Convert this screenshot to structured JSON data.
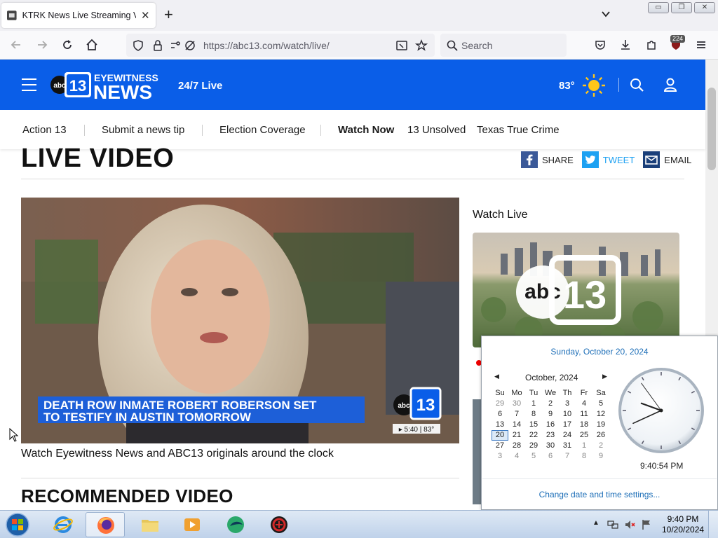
{
  "browser": {
    "tab_title": "KTRK News Live Streaming Vide",
    "url": "https://abc13.com/watch/live/",
    "search_placeholder": "Search",
    "extension_badge": "224"
  },
  "site": {
    "logo_text_top": "EYEWITNESS",
    "logo_text_bottom": "NEWS",
    "logo_badge": "abc13",
    "live_label": "24/7 Live",
    "temperature": "83°",
    "nav": [
      "Action 13",
      "Submit a news tip",
      "Election Coverage",
      "Watch Now",
      "13 Unsolved",
      "Texas True Crime"
    ]
  },
  "page": {
    "title": "LIVE VIDEO",
    "share": {
      "facebook": "SHARE",
      "twitter": "TWEET",
      "email": "EMAIL"
    },
    "video": {
      "lower_third_line1": "DEATH ROW INMATE ROBERT ROBERSON SET",
      "lower_third_line2": "TO TESTIFY IN AUSTIN TOMORROW",
      "bug": "abc13",
      "ticker": "▸ 5:40 | 83°"
    },
    "video_caption": "Watch Eyewitness News and ABC13 originals around the clock",
    "recommended_title": "RECOMMENDED VIDEO",
    "sidebar_heading": "Watch Live",
    "thumb_logo": "abc13"
  },
  "clock_popup": {
    "long_date": "Sunday, October 20, 2024",
    "month_label": "October, 2024",
    "weekdays": [
      "Su",
      "Mo",
      "Tu",
      "We",
      "Th",
      "Fr",
      "Sa"
    ],
    "weeks": [
      [
        "29",
        "30",
        "1",
        "2",
        "3",
        "4",
        "5"
      ],
      [
        "6",
        "7",
        "8",
        "9",
        "10",
        "11",
        "12"
      ],
      [
        "13",
        "14",
        "15",
        "16",
        "17",
        "18",
        "19"
      ],
      [
        "20",
        "21",
        "22",
        "23",
        "24",
        "25",
        "26"
      ],
      [
        "27",
        "28",
        "29",
        "30",
        "31",
        "1",
        "2"
      ],
      [
        "3",
        "4",
        "5",
        "6",
        "7",
        "8",
        "9"
      ]
    ],
    "today": "20",
    "digital_time": "9:40:54 PM",
    "settings_link": "Change date and time settings..."
  },
  "taskbar": {
    "time": "9:40 PM",
    "date": "10/20/2024",
    "apps": [
      "internet-explorer",
      "firefox",
      "file-explorer",
      "media-player",
      "app-green",
      "app-red"
    ]
  },
  "colors": {
    "brand_blue": "#0a5ee8",
    "link_blue": "#1e6fb8",
    "lower_third_blue": "#1d5fd8"
  }
}
